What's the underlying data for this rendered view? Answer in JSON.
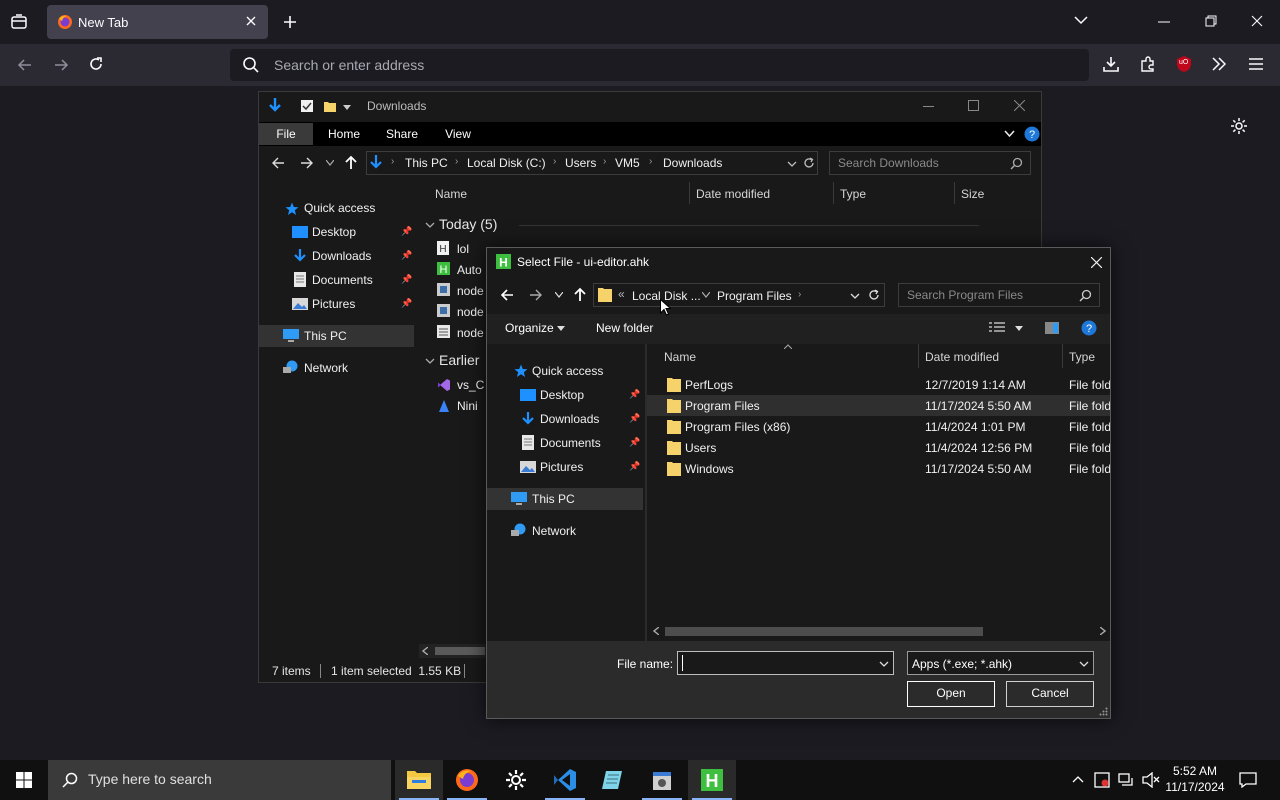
{
  "browser": {
    "tab_title": "New Tab",
    "url_placeholder": "Search or enter address",
    "ublock_badge": "uO"
  },
  "explorer": {
    "title": "Downloads",
    "ribbon_tabs": [
      "File",
      "Home",
      "Share",
      "View"
    ],
    "breadcrumb": [
      "This PC",
      "Local Disk (C:)",
      "Users",
      "VM5",
      "Downloads"
    ],
    "search_placeholder": "Search Downloads",
    "columns": [
      "Name",
      "Date modified",
      "Type",
      "Size"
    ],
    "nav": {
      "quick_access": "Quick access",
      "desktop": "Desktop",
      "downloads": "Downloads",
      "documents": "Documents",
      "pictures": "Pictures",
      "this_pc": "This PC",
      "network": "Network"
    },
    "groups": {
      "today": "Today (5)",
      "earlier": "Earlier"
    },
    "today_files": [
      "lol",
      "Auto",
      "node",
      "node",
      "node"
    ],
    "earlier_files": [
      "vs_C",
      "Nini"
    ],
    "status": {
      "items": "7 items",
      "selected": "1 item selected  1.55 KB"
    }
  },
  "dialog": {
    "title": "Select File - ui-editor.ahk",
    "breadcrumb": {
      "overflow": "«",
      "parent": "Local Disk ...",
      "current": "Program Files"
    },
    "search_placeholder": "Search Program Files",
    "toolbar": {
      "organize": "Organize",
      "new_folder": "New folder"
    },
    "nav": {
      "quick_access": "Quick access",
      "desktop": "Desktop",
      "downloads": "Downloads",
      "documents": "Documents",
      "pictures": "Pictures",
      "this_pc": "This PC",
      "network": "Network"
    },
    "columns": [
      "Name",
      "Date modified",
      "Type"
    ],
    "files": [
      {
        "name": "PerfLogs",
        "date": "12/7/2019 1:14 AM",
        "type": "File fold"
      },
      {
        "name": "Program Files",
        "date": "11/17/2024 5:50 AM",
        "type": "File fold"
      },
      {
        "name": "Program Files (x86)",
        "date": "11/4/2024 1:01 PM",
        "type": "File fold"
      },
      {
        "name": "Users",
        "date": "11/4/2024 12:56 PM",
        "type": "File fold"
      },
      {
        "name": "Windows",
        "date": "11/17/2024 5:50 AM",
        "type": "File fold"
      }
    ],
    "file_name_label": "File name:",
    "file_name_value": "",
    "filter": "Apps (*.exe; *.ahk)",
    "open_label": "Open",
    "cancel_label": "Cancel"
  },
  "taskbar": {
    "search_placeholder": "Type here to search",
    "time": "5:52 AM",
    "date": "11/17/2024"
  },
  "colors": {
    "accent_blue": "#1e90ff",
    "folder_yellow": "#f5d36a",
    "ahk_green": "#3fbf3f"
  }
}
